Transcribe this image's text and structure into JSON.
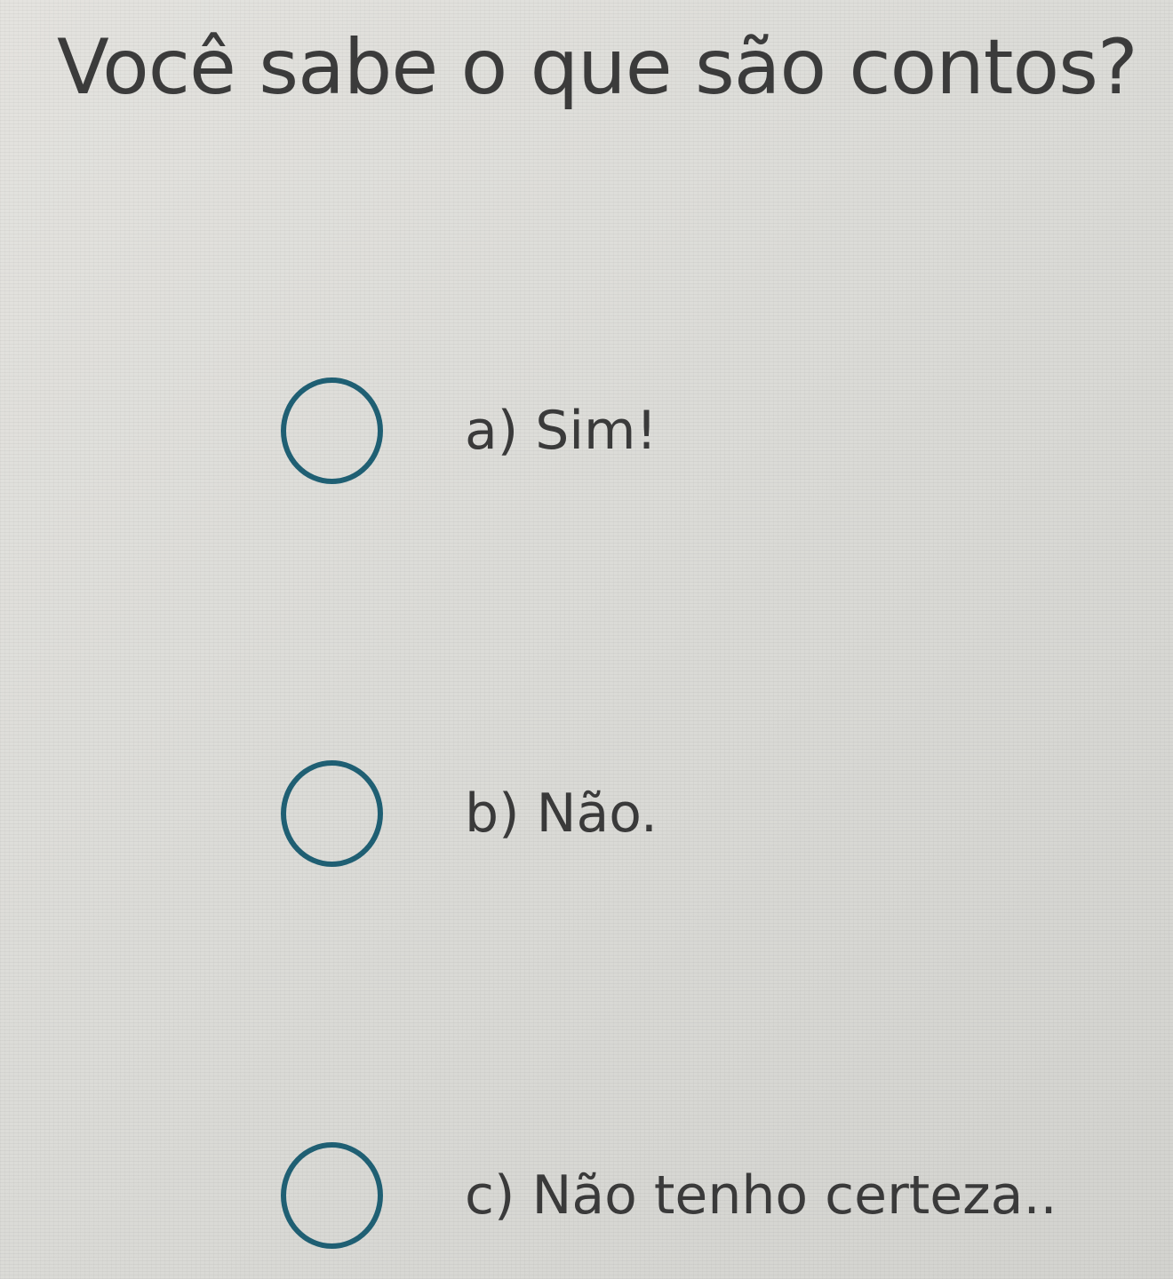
{
  "question": {
    "text": "Você sabe o que são contos?"
  },
  "options": [
    {
      "label": "a) Sim!",
      "selected": false
    },
    {
      "label": "b) Não.",
      "selected": false
    },
    {
      "label": "c) Não tenho certeza..",
      "selected": false
    }
  ],
  "colors": {
    "radio_border": "#1f5f73",
    "text": "#3a3a3a",
    "background": "#dcdcd8"
  }
}
